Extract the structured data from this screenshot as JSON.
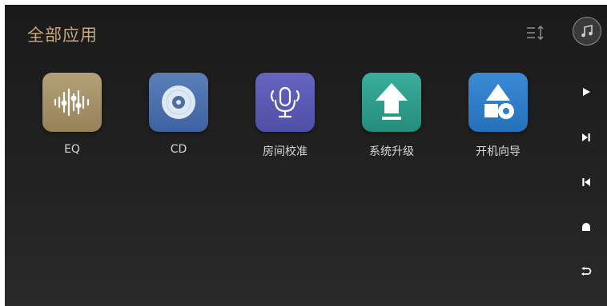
{
  "header": {
    "title": "全部应用"
  },
  "apps": [
    {
      "label": "EQ",
      "icon": "equalizer-icon",
      "color": "#a8936a"
    },
    {
      "label": "CD",
      "icon": "disc-icon",
      "color": "#4a6fa8"
    },
    {
      "label": "房间校准",
      "icon": "microphone-icon",
      "color": "#5a5ab4"
    },
    {
      "label": "系统升级",
      "icon": "upload-arrow-icon",
      "color": "#2e9c8c"
    },
    {
      "label": "开机向导",
      "icon": "shapes-icon",
      "color": "#2f7fc9"
    }
  ],
  "sidebar": {
    "controls": [
      "music-icon",
      "play-icon",
      "next-track-icon",
      "previous-track-icon",
      "eject-icon",
      "back-icon"
    ]
  }
}
